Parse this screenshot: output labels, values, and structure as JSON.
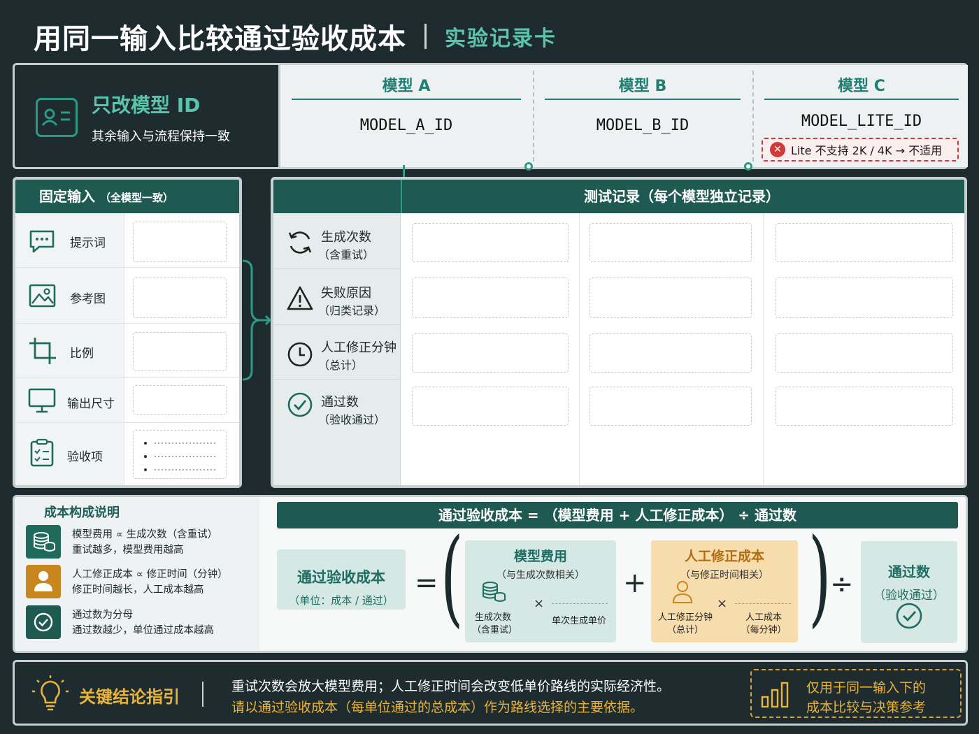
{
  "title": {
    "main": "用同一输入比较通过验收成本",
    "sub": "实验记录卡"
  },
  "only_change": {
    "title": "只改模型 ID",
    "subtitle": "其余输入与流程保持一致"
  },
  "models": [
    {
      "label": "模型 A",
      "id": "MODEL_A_ID"
    },
    {
      "label": "模型 B",
      "id": "MODEL_B_ID"
    },
    {
      "label": "模型 C",
      "id": "MODEL_LITE_ID",
      "warning": "Lite 不支持 2K / 4K → 不适用"
    }
  ],
  "fixed_inputs": {
    "title": "固定输入",
    "title_note": "（全模型一致）",
    "items": [
      {
        "label": "提示词",
        "icon": "chat-bubble-icon"
      },
      {
        "label": "参考图",
        "icon": "image-icon"
      },
      {
        "label": "比例",
        "icon": "crop-icon"
      },
      {
        "label": "输出尺寸",
        "icon": "monitor-icon"
      },
      {
        "label": "验收项",
        "icon": "checklist-icon"
      }
    ]
  },
  "records": {
    "title": "测试记录（每个模型独立记录）",
    "rows": [
      {
        "line1": "生成次数",
        "line2": "（含重试）",
        "icon": "refresh-icon"
      },
      {
        "line1": "失败原因",
        "line2": "（归类记录）",
        "icon": "warning-icon"
      },
      {
        "line1": "人工修正分钟",
        "line2": "（总计）",
        "icon": "clock-icon"
      },
      {
        "line1": "通过数",
        "line2": "（验收通过）",
        "icon": "check-circle-icon"
      }
    ]
  },
  "cost": {
    "title": "成本构成说明",
    "items": [
      {
        "line1": "模型费用  ∝  生成次数（含重试）",
        "line2": "重试越多，模型费用越高",
        "icon": "coins-icon",
        "color": "#1e6a5c"
      },
      {
        "line1": "人工修正成本  ∝  修正时间（分钟）",
        "line2": "修正时间越长，人工成本越高",
        "icon": "person-icon",
        "color": "#c8861f"
      },
      {
        "line1": "通过数为分母",
        "line2": "通过数越少，单位通过成本越高",
        "icon": "check-circle-icon",
        "color": "#1e5a52"
      }
    ],
    "formula_bar": "通过验收成本  =  （模型费用 + 人工修正成本）  ÷  通过数",
    "result": {
      "title": "通过验收成本",
      "unit": "（单位：成本 / 通过）"
    },
    "model_fee": {
      "title": "模型费用",
      "note": "（与生成次数相关）",
      "a1": "生成次数",
      "a2": "（含重试）",
      "b": "单次生成单价"
    },
    "labor_cost": {
      "title": "人工修正成本",
      "note": "（与修正时间相关）",
      "a1": "人工修正分钟",
      "a2": "（总计）",
      "b1": "人工成本",
      "b2": "（每分钟）"
    },
    "passes": {
      "title": "通过数",
      "note": "（验收通过）"
    },
    "ops": {
      "eq": "=",
      "plus": "+",
      "times": "×",
      "div": "÷",
      "lparen": "(",
      "rparen": ")"
    }
  },
  "conclusion": {
    "key": "关键结论指引",
    "line1": "重试次数会放大模型费用；人工修正时间会改变低单价路线的实际经济性。",
    "line2": "请以通过验收成本（每单位通过的总成本）作为路线选择的主要依据。",
    "scope1": "仅用于同一输入下的",
    "scope2": "成本比较与决策参考"
  },
  "colors": {
    "teal": "#1e5a52",
    "accent": "#5cc3ad",
    "amber": "#e8b43a",
    "red": "#d23a3a"
  }
}
